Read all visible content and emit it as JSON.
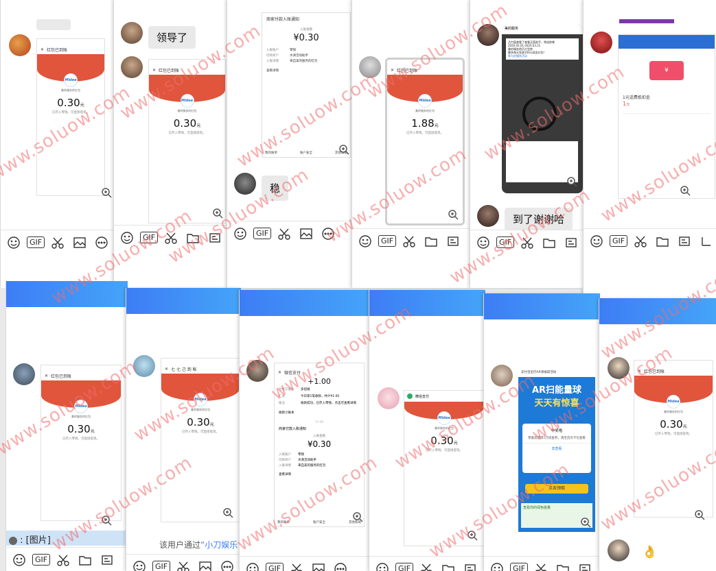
{
  "chat": {
    "messages": {
      "m1": "领导了",
      "m2": "稳",
      "m3": "到了谢谢哈"
    },
    "bottom_left_preview": ": [图片]",
    "system_notice_prefix": "该用户通过",
    "system_notice_link": "“小刀娱乐",
    "gif_label": "GIF"
  },
  "phone": {
    "nav_title": "红包已到账",
    "nav_title_alt": "七 七 己 到 帐",
    "brand_logo": "Midea",
    "sender": "美的服务的红包",
    "received_note": "已存入零钱，可直接提现。",
    "amount_a": "0.30",
    "amount_b": "1.88",
    "unit": "元"
  },
  "notice": {
    "title": "商家付款入账通知",
    "label": "入账金额",
    "amount": "¥0.30",
    "rows": [
      {
        "k": "入账账户",
        "v": "零钱"
      },
      {
        "k": "付款商户",
        "v": "水滴活动助手"
      },
      {
        "k": "入账详情",
        "v": "来自美的服务的红包"
      }
    ],
    "detail": "查看详情",
    "menu": [
      "我的账单",
      "账户安全",
      "其他帮助"
    ]
  },
  "wechat_pay": {
    "title": "微信支付",
    "amount": "+1.00",
    "rows": [
      {
        "k": "付款方备注",
        "v": "多扭福"
      },
      {
        "k": "汇总",
        "v": "今日第1笔收款，共计¥1.00"
      },
      {
        "k": "备注",
        "v": "收款成功，已存入零钱，点击可查看详情"
      }
    ],
    "small_program": "收款小账本",
    "time": "17:39"
  },
  "alipay": {
    "title": "支付宝出行AR领福袋活动",
    "banner": "AR扫能量球",
    "banner2": "天天有惊喜",
    "dialog_title": "中奖啦",
    "dialog_text": "恭喜您获得1元现金券，请至首页卡包查看",
    "dialog_link": "去查看",
    "button": "点击领取",
    "footer": "查看你的绿色能量"
  },
  "coupon": {
    "title": "1元话费抵扣金",
    "amount": "1",
    "unit": "元"
  },
  "merchant_chat": {
    "title": "美的服务",
    "line1": "活力值查看了查看买菜助手，将追踪哪",
    "line2": "2020.03.01-2020.03.31",
    "line3": "美的服务首页大型转",
    "line4": "最多每天发放100元现金红包！",
    "link": "参与定服务活动"
  },
  "watermark": "www.soluow.com",
  "colors": {
    "accent_blue": "#3d7df5",
    "red_packet": "#e0553b",
    "wechat_green": "#2aae67"
  }
}
